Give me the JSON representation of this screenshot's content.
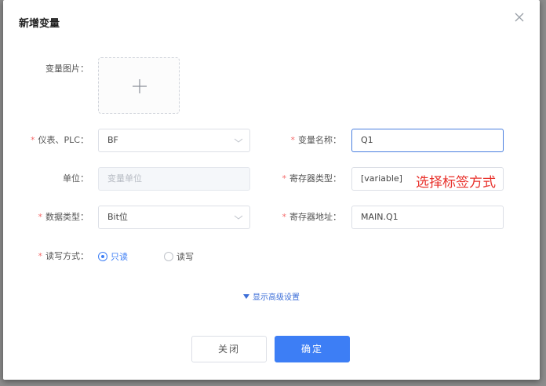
{
  "dialog": {
    "title": "新增变量",
    "close_icon": "close-icon"
  },
  "form": {
    "image_label": "变量图片：",
    "meter_label": "仪表、PLC：",
    "meter_value": "BF",
    "var_name_label": "变量名称：",
    "var_name_value": "Q1",
    "unit_label": "单位：",
    "unit_placeholder": "变量单位",
    "register_type_label": "寄存器类型：",
    "register_type_value": "[variable]",
    "data_type_label": "数据类型：",
    "data_type_value": "Bit位",
    "register_addr_label": "寄存器地址：",
    "register_addr_value": "MAIN.Q1",
    "rw_label": "读写方式：",
    "rw_options": [
      "只读",
      "读写"
    ],
    "rw_selected": "只读",
    "required_mark": "*"
  },
  "annotation": "选择标签方式",
  "advanced_link": "显示高级设置",
  "buttons": {
    "cancel": "关闭",
    "ok": "确定"
  },
  "colors": {
    "primary": "#3d7ef5",
    "required": "#f56c6c",
    "annotation": "#e8302a"
  }
}
